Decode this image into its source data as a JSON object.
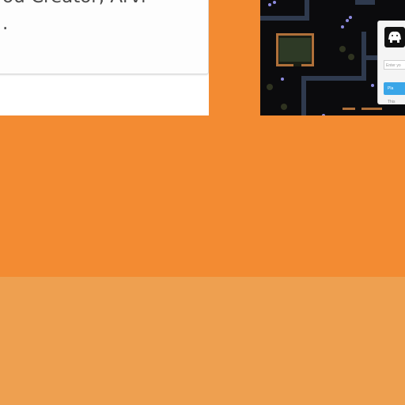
{
  "quote": {
    "line1": "ou Creator, Arvi",
    "line2": "."
  },
  "game_login": {
    "logo_icon": "pig-icon",
    "input_placeholder": "Enter yo",
    "button_label": "Pla",
    "footer_text": "This"
  },
  "colors": {
    "background_orange": "#f38b32",
    "bottom_band": "#eea050",
    "game_background": "#0b0b0d",
    "button_blue": "#3aa6e8"
  }
}
